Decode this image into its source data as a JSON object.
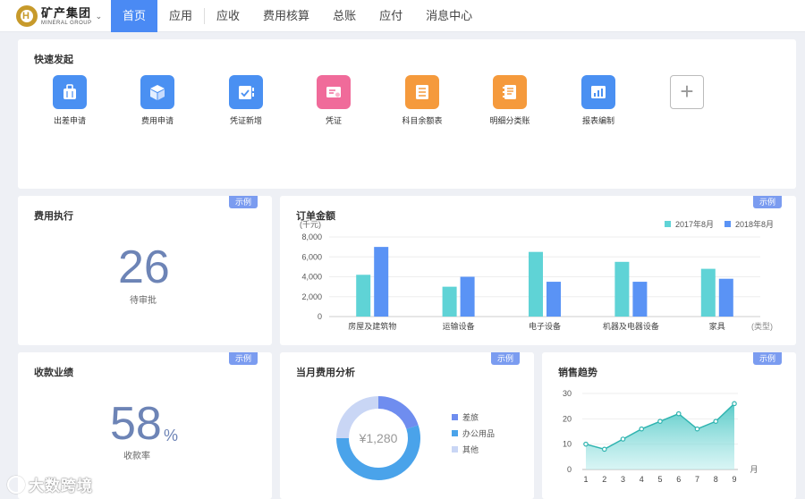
{
  "brand": {
    "name_cn": "矿产集团",
    "name_en": "MINERAL GROUP"
  },
  "nav": [
    "首页",
    "应用",
    "应收",
    "费用核算",
    "总账",
    "应付",
    "消息中心"
  ],
  "nav_active": "首页",
  "sample_tag": "示例",
  "quick_launch": {
    "title": "快速发起",
    "items": [
      {
        "label": "出差申请",
        "icon": "suitcase-icon",
        "color": "#4a90f2"
      },
      {
        "label": "费用申请",
        "icon": "cube-icon",
        "color": "#4a90f2"
      },
      {
        "label": "凭证新增",
        "icon": "voucher-add-icon",
        "color": "#4a90f2"
      },
      {
        "label": "凭证",
        "icon": "voucher-icon",
        "color": "#f06b9a"
      },
      {
        "label": "科目余额表",
        "icon": "balance-sheet-icon",
        "color": "#f59a3c"
      },
      {
        "label": "明细分类账",
        "icon": "ledger-icon",
        "color": "#f59a3c"
      },
      {
        "label": "报表编制",
        "icon": "report-chart-icon",
        "color": "#4a90f2"
      }
    ]
  },
  "expense_exec": {
    "title": "费用执行",
    "value": "26",
    "caption": "待审批"
  },
  "collection": {
    "title": "收款业绩",
    "value": "58",
    "unit": "%",
    "caption": "收款率"
  },
  "order_amount": {
    "title": "订单金额",
    "y_unit": "(千元)",
    "x_unit": "(类型)"
  },
  "expense_analysis": {
    "title": "当月费用分析",
    "center": "¥1,280",
    "legend": [
      {
        "label": "差旅",
        "color": "#6f8def"
      },
      {
        "label": "办公用品",
        "color": "#4aa3ea"
      },
      {
        "label": "其他",
        "color": "#c9d6f5"
      }
    ]
  },
  "sales_trend": {
    "title": "销售趋势",
    "x_unit": "月"
  },
  "watermark": "大数跨境",
  "chart_data": [
    {
      "type": "bar",
      "title": "订单金额",
      "ylabel": "(千元)",
      "xlabel": "(类型)",
      "categories": [
        "房屋及建筑物",
        "运输设备",
        "电子设备",
        "机器及电器设备",
        "家具"
      ],
      "series": [
        {
          "name": "2017年8月",
          "color": "#5fd3d6",
          "values": [
            4200,
            3000,
            6500,
            5500,
            4800
          ]
        },
        {
          "name": "2018年8月",
          "color": "#5a93f5",
          "values": [
            7000,
            4000,
            3500,
            3500,
            3800
          ]
        }
      ],
      "ylim": [
        0,
        8000
      ],
      "yticks": [
        "0",
        "2,000",
        "4,000",
        "6,000",
        "8,000"
      ],
      "legend": "top-right",
      "grid": true
    },
    {
      "type": "pie",
      "title": "当月费用分析",
      "labels": [
        "差旅",
        "办公用品",
        "其他"
      ],
      "values": [
        20,
        55,
        25
      ],
      "center_text": "¥1,280"
    },
    {
      "type": "area",
      "title": "销售趋势",
      "x": [
        1,
        2,
        3,
        4,
        5,
        6,
        7,
        8,
        9
      ],
      "values": [
        10,
        8,
        12,
        16,
        19,
        22,
        16,
        19,
        26
      ],
      "ylim": [
        0,
        30
      ],
      "yticks": [
        "0",
        "10",
        "20",
        "30"
      ],
      "xlabel": "月"
    }
  ]
}
